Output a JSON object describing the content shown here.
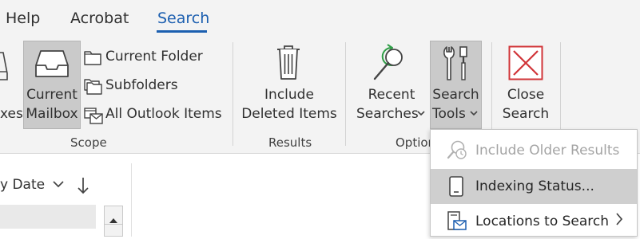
{
  "tabs": [
    {
      "label": "Help"
    },
    {
      "label": "Acrobat"
    },
    {
      "label": "Search"
    }
  ],
  "ribbon": {
    "mailboxes_partial": "xes",
    "current_mailbox": {
      "line1": "Current",
      "line2": "Mailbox"
    },
    "scope_items": [
      {
        "label": "Current Folder"
      },
      {
        "label": "Subfolders"
      },
      {
        "label": "All Outlook Items"
      }
    ],
    "include_deleted": {
      "line1": "Include",
      "line2": "Deleted Items"
    },
    "recent_searches": {
      "line1": "Recent",
      "line2": "Searches"
    },
    "search_tools": {
      "line1": "Search",
      "line2": "Tools"
    },
    "close_search": {
      "line1": "Close",
      "line2": "Search"
    },
    "groups": {
      "scope": "Scope",
      "results": "Results",
      "options_partial": "Option"
    }
  },
  "list_pane": {
    "sort_label": "y Date"
  },
  "dropdown": {
    "items": [
      {
        "label": "Include Older Results",
        "enabled": false
      },
      {
        "label": "Indexing Status...",
        "enabled": true
      },
      {
        "label": "Locations to Search",
        "enabled": true
      }
    ]
  },
  "colors": {
    "accent": "#1c5fb0",
    "close_red": "#d13438",
    "recent_green": "#2e9d45"
  }
}
